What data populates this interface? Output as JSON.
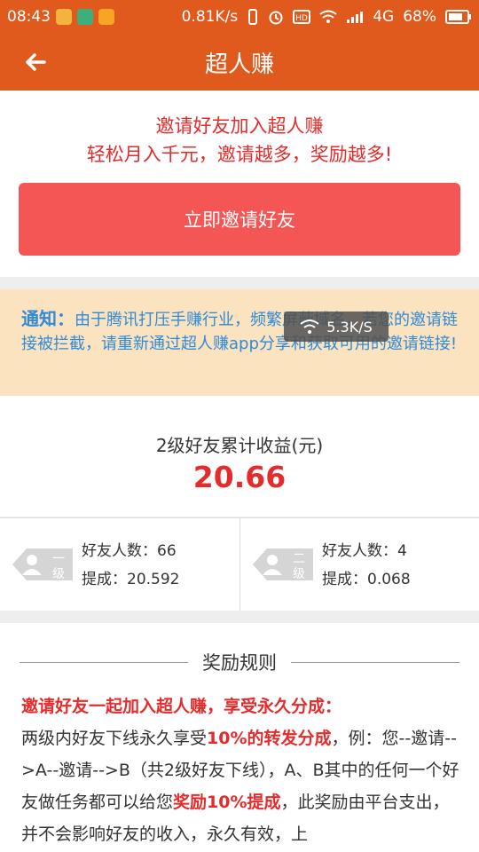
{
  "status_bar": {
    "time": "08:43",
    "speed": "0.81K/s",
    "network": "4G",
    "battery": "68%"
  },
  "app_bar": {
    "title": "超人赚",
    "back_icon": "arrow-left-icon"
  },
  "invite": {
    "line1": "邀请好友加入超人赚",
    "line2": "轻松月入千元，邀请越多，奖励越多!",
    "button_label": "立即邀请好友"
  },
  "notice": {
    "label": "通知：",
    "text": "由于腾讯打压手赚行业，频繁屏蔽域名，若您的邀请链接被拦截，请重新通过超人赚app分享和获取可用的邀请链接!"
  },
  "toast": {
    "text": "5.3K/S"
  },
  "earnings": {
    "label": "2级好友累计收益(元)",
    "value": "20.66"
  },
  "levels": [
    {
      "badge_top": "一",
      "badge_bottom": "级",
      "friends": "好友人数：66",
      "commission": "提成：20.592"
    },
    {
      "badge_top": "二",
      "badge_bottom": "级",
      "friends": "好友人数：4",
      "commission": "提成：0.068"
    }
  ],
  "rules": {
    "heading": "奖励规则",
    "highlight": "邀请好友一起加入超人赚，享受永久分成：",
    "p1": "两级内好友下线永久享受",
    "p1_red": "10%的转发分成",
    "p2": "，例：您--邀请-->A--邀请-->B（共2级好友下线），A、B其中的任何一个好友做任务都可以给您",
    "p2_red": "奖励10%提成",
    "p3": "，此奖励由平台支出，并不会影响好友的收入，永久有效，上"
  },
  "colors": {
    "brand": "#e05a1e",
    "accent_red": "#e52b2b",
    "button": "#f45656",
    "notice_bg": "#fbe3bf",
    "notice_text": "#2f8ad8"
  }
}
